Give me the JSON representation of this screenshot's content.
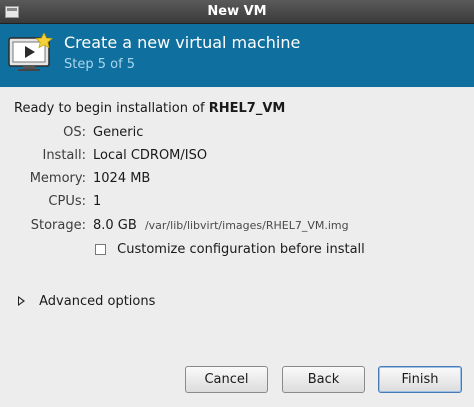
{
  "window": {
    "title": "New VM"
  },
  "header": {
    "title": "Create a new virtual machine",
    "step": "Step 5 of 5"
  },
  "summary": {
    "ready_prefix": "Ready to begin installation of",
    "vm_name": "RHEL7_VM",
    "rows": [
      {
        "label": "OS:",
        "value": "Generic"
      },
      {
        "label": "Install:",
        "value": "Local CDROM/ISO"
      },
      {
        "label": "Memory:",
        "value": "1024 MB"
      },
      {
        "label": "CPUs:",
        "value": "1"
      },
      {
        "label": "Storage:",
        "value": "8.0 GB",
        "path": "/var/lib/libvirt/images/RHEL7_VM.img"
      }
    ]
  },
  "customize": {
    "label": "Customize configuration before install",
    "checked": false
  },
  "advanced": {
    "label": "Advanced options",
    "expanded": false
  },
  "buttons": {
    "cancel": "Cancel",
    "back": "Back",
    "finish": "Finish"
  },
  "colors": {
    "banner": "#0f6f9e",
    "step_text": "#a9d6ef",
    "background": "#ededed"
  },
  "icons": {
    "window_menu": "window-menu-icon",
    "header": "virtual-machine-icon",
    "expander": "expander-right-icon"
  }
}
